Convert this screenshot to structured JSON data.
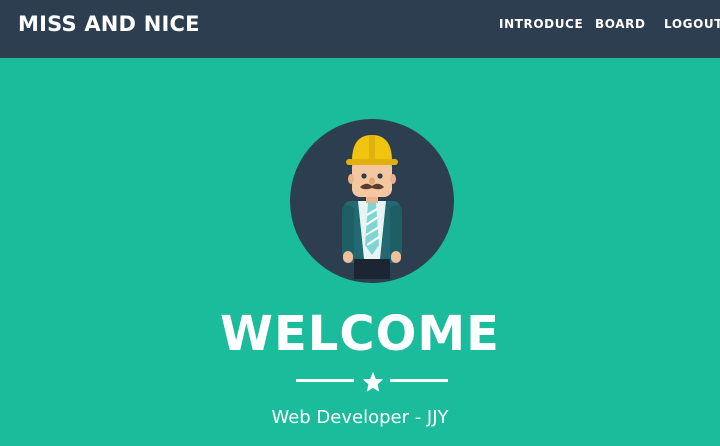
{
  "navbar": {
    "brand": "MISS AND NICE",
    "links": [
      {
        "label": "INTRODUCE"
      },
      {
        "label": "BOARD"
      },
      {
        "label": "LOGOUT"
      }
    ]
  },
  "masthead": {
    "avatar_icon": "developer-avatar-icon",
    "title": "WELCOME",
    "divider_icon": "star-icon",
    "subtitle": "Web Developer - JJY"
  },
  "colors": {
    "navbar_bg": "#2c3e50",
    "masthead_bg": "#1abc9c",
    "text": "#ffffff",
    "helmet": "#f1c40f"
  }
}
